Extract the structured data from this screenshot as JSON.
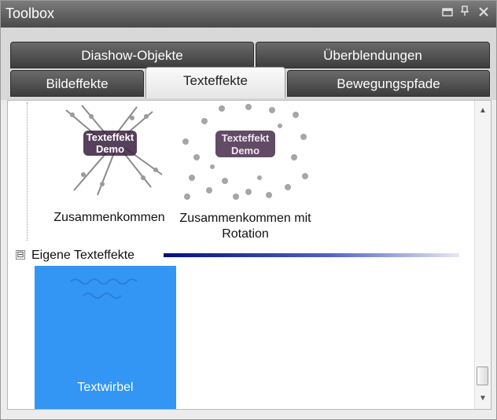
{
  "window": {
    "title": "Toolbox",
    "buttons": {
      "dock": "▬",
      "pin": "ꟷ",
      "close": "✕"
    }
  },
  "tabs": {
    "row1": [
      {
        "label": "Diashow-Objekte",
        "active": false
      },
      {
        "label": "Überblendungen",
        "active": false
      }
    ],
    "row2": [
      {
        "label": "Bildeffekte",
        "active": false
      },
      {
        "label": "Texteffekte",
        "active": true
      },
      {
        "label": "Bewegungspfade",
        "active": false
      }
    ]
  },
  "effects": {
    "items": [
      {
        "label": "Zusammenkommen",
        "thumb_text_1": "Texteffekt",
        "thumb_text_2": "Demo"
      },
      {
        "label_1": "Zusammenkommen mit",
        "label_2": "Rotation",
        "thumb_text_1": "Texteffekt",
        "thumb_text_2": "Demo"
      }
    ],
    "group": {
      "expander": "⊟",
      "label": "Eigene Texteffekte"
    },
    "custom": [
      {
        "label": "Textwirbel",
        "selected": true
      }
    ]
  },
  "colors": {
    "selection": "#3396f5",
    "titlebar": "#5a5a5a",
    "group_bar": "#001080"
  }
}
